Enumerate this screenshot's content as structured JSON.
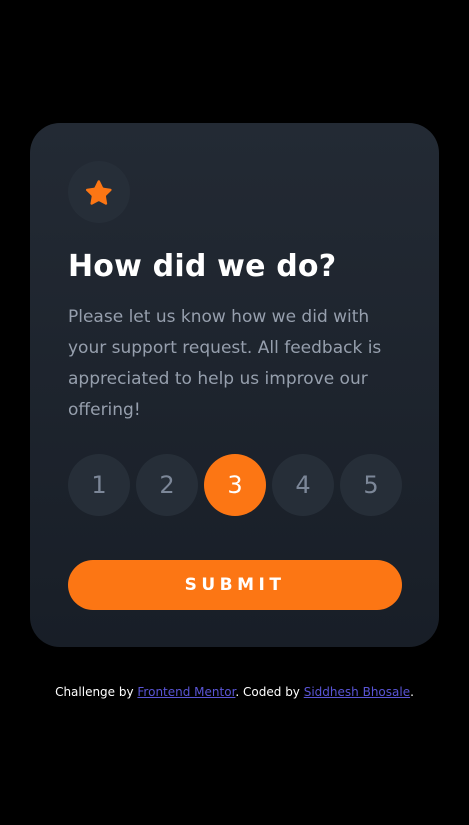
{
  "colors": {
    "page_background": "#000000",
    "card_background_top": "#232a34",
    "card_background_bottom": "#181e27",
    "circle_background": "#262e38",
    "accent": "#fc7614",
    "text_muted": "#969fad",
    "rating_text": "#7c8798",
    "link": "#5a55d6"
  },
  "card": {
    "icon": "star-icon",
    "title": "How did we do?",
    "description": "Please let us know how we did with your support request. All feedback is appreciated to help us improve our offering!",
    "ratings": [
      {
        "label": "1",
        "selected": false
      },
      {
        "label": "2",
        "selected": false
      },
      {
        "label": "3",
        "selected": true
      },
      {
        "label": "4",
        "selected": false
      },
      {
        "label": "5",
        "selected": false
      }
    ],
    "submit_label": "SUBMIT"
  },
  "attribution": {
    "prefix": "Challenge by ",
    "link1_text": "Frontend Mentor",
    "middle": ". Coded by ",
    "link2_text": "Siddhesh Bhosale",
    "suffix": "."
  }
}
